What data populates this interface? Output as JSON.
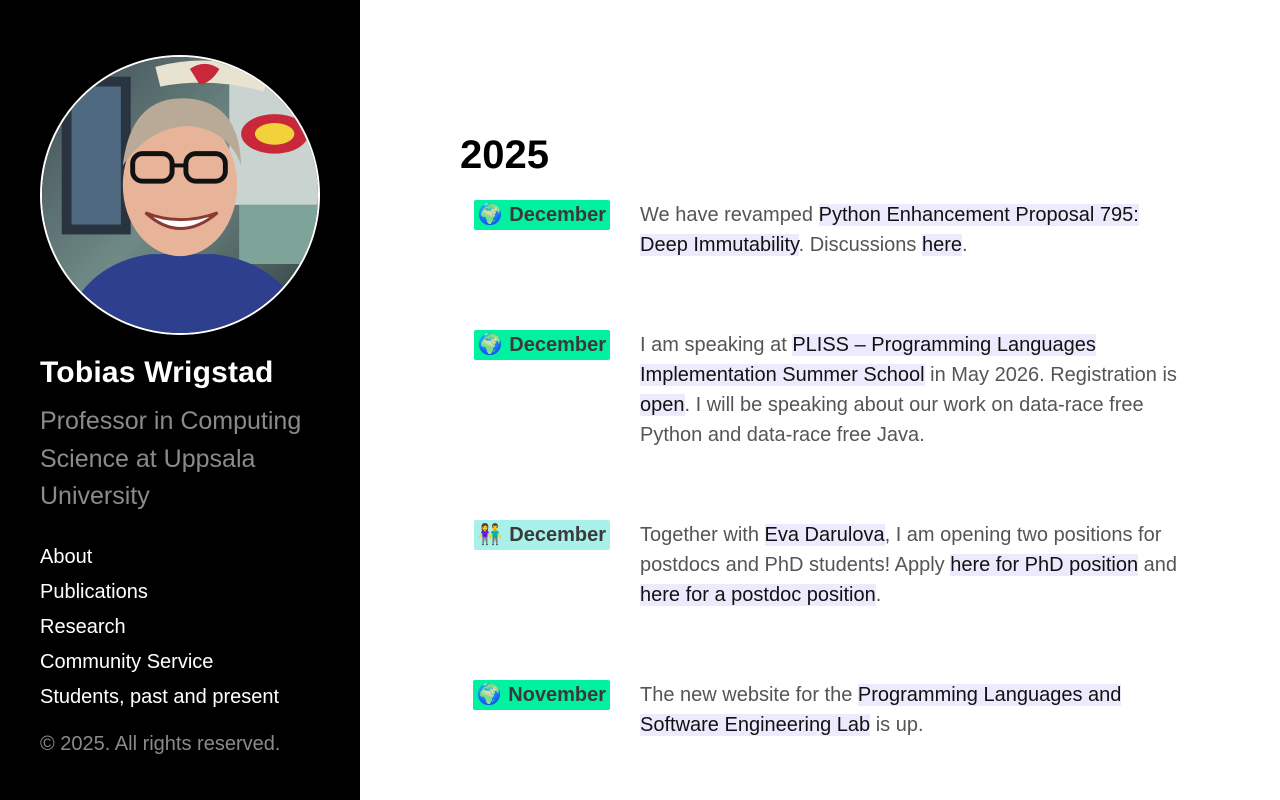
{
  "sidebar": {
    "name": "Tobias Wrigstad",
    "subtitle": "Professor in Computing Science at Uppsala University",
    "nav": [
      "About",
      "Publications",
      "Research",
      "Community Service",
      "Students, past and present"
    ],
    "copyright": "© 2025. All rights reserved."
  },
  "main": {
    "year": "2025",
    "entries": [
      {
        "emoji": "🌍",
        "month": "December",
        "badge_color": "#00f2a0",
        "t0": "We have revamped ",
        "l0": "Python Enhancement Proposal 795: Deep Immutability",
        "t1": ". Discussions ",
        "l1": "here",
        "t2": "."
      },
      {
        "emoji": "🌍",
        "month": "December",
        "badge_color": "#00f2a0",
        "t0": "I am speaking at ",
        "l0": "PLISS – Programming Languages Implementation Summer School",
        "t1": " in May 2026. Registration is ",
        "l1": "open",
        "t2": ". I will be speaking about our work on data-race free Python and data-race free Java."
      },
      {
        "emoji": "👫",
        "month": "December",
        "badge_color": "#a8f0ea",
        "t0": "Together with ",
        "l0": "Eva Darulova",
        "t1": ", I am opening two positions for postdocs and PhD students! Apply ",
        "l1": "here for PhD position",
        "t2": " and ",
        "l2": "here for a postdoc position",
        "t3": "."
      },
      {
        "emoji": "🌍",
        "month": "November",
        "badge_color": "#00f2a0",
        "t0": "The new website for the ",
        "l0": "Programming Languages and Software Engineering Lab",
        "t1": " is up."
      }
    ]
  },
  "colors": {
    "sidebar_bg": "#000000",
    "link_bg": "#eceafc",
    "badge_globe": "#00f2a0",
    "badge_people": "#a8f0ea"
  },
  "icons": {
    "globe": "globe-emoji",
    "people": "people-emoji"
  }
}
